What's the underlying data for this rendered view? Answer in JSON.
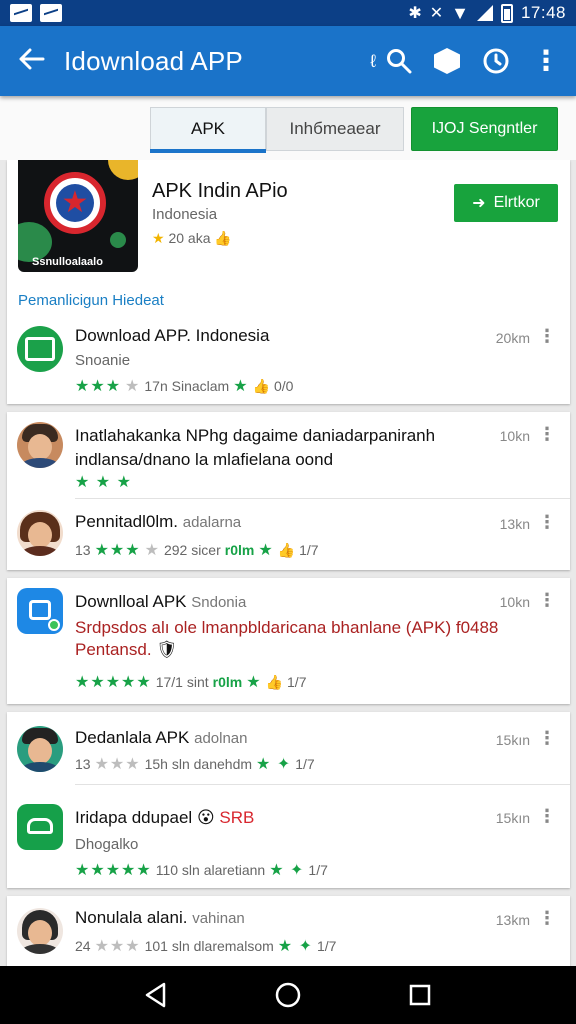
{
  "status_bar": {
    "time": "17:48"
  },
  "app_bar": {
    "title": "Idownload APP",
    "small_text": "ℓ"
  },
  "tabs": {
    "apk": "APK",
    "info": "Inhбmeaear",
    "green": "IJOJ Sengntler"
  },
  "featured": {
    "title": "APK Indin APio",
    "subtitle": "Indonesia",
    "rating": "20 aka",
    "image_caption": "Ssnulloalaalo",
    "button_label": "Elrtkor"
  },
  "section_title": "Pemanlicigun Hiedeat",
  "items": [
    {
      "title": "Download APP.",
      "title_extra": "Indonesia",
      "subtitle": "Snoanie",
      "meta": "17n Sinaclam",
      "meta_tail": "0/0",
      "size": "20km"
    },
    {
      "title": "Inatlahakanka NPhg dagaime daniadarpaniranh",
      "desc": "indlansa/dnano la mlafielana oond",
      "size": "10kn"
    },
    {
      "title": "Pennitadl0lm.",
      "title_light": "adalarna",
      "meta_prefix": "13",
      "meta": "292 sicer",
      "meta_green": "r0lm",
      "meta_tail": "1/7",
      "size": "13kn"
    },
    {
      "title": "Downlloal APK",
      "title_light": "Sndonia",
      "desc": "Srdpsdos alı ole lmanpbldaricana bhanlane (APK) f0488",
      "desc2": "Pentansd.",
      "meta": "17/1 sint",
      "meta_green": "r0lm",
      "meta_tail": "1/7",
      "size": "10kn"
    },
    {
      "title": "Dedanlala APK",
      "title_light": "adolnan",
      "meta_prefix": "13",
      "meta": "15h sln danehdm",
      "meta_tail": "1/7",
      "size": "15kın"
    },
    {
      "title": "Iridapa ddupael",
      "title_red": "SRB",
      "subtitle": "Dhogalko",
      "meta": "110 sln alaretiann",
      "meta_tail": "1/7",
      "size": "15kın"
    },
    {
      "title": "Nonulala alani.",
      "title_light": "vahinan",
      "meta_prefix": "24",
      "meta": "101 sln dlaremalsom",
      "meta_tail": "1/7",
      "size": "13km"
    }
  ],
  "colors": {
    "primary": "#1a73c9",
    "status": "#0c3f86",
    "green": "#18a33d",
    "link": "#1a7fc4"
  }
}
